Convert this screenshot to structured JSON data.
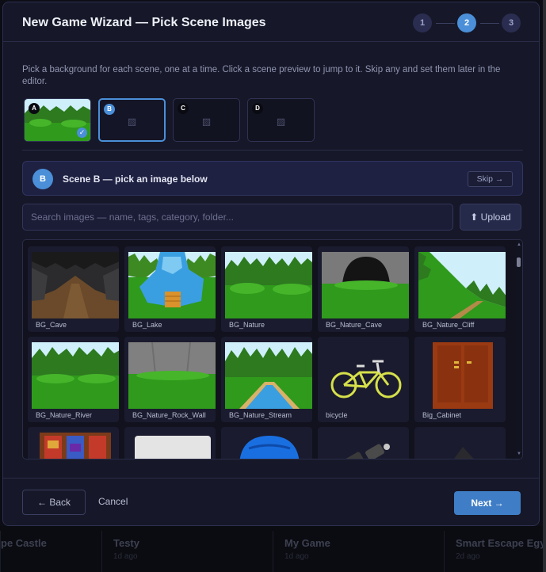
{
  "background": {
    "games": [
      {
        "title": "pe Castle",
        "sub": ""
      },
      {
        "title": "Testy",
        "sub": "1d ago"
      },
      {
        "title": "My Game",
        "sub": "1d ago"
      },
      {
        "title": "Smart Escape Egyp",
        "sub": "2d ago"
      }
    ]
  },
  "dialog": {
    "title": "New Game Wizard — Pick Scene Images",
    "steps": [
      "1",
      "2",
      "3"
    ],
    "active_step": 2,
    "intro": "Pick a background for each scene, one at a time. Click a scene preview to jump to it. Skip any and set them later in the editor.",
    "scenes": [
      {
        "letter": "A",
        "state": "done"
      },
      {
        "letter": "B",
        "state": "selected"
      },
      {
        "letter": "C",
        "state": "empty"
      },
      {
        "letter": "D",
        "state": "empty"
      }
    ],
    "current_scene": {
      "letter": "B",
      "label": "Scene B — pick an image below",
      "skip_label": "Skip →"
    },
    "search": {
      "placeholder": "Search images — name, tags, category, folder...",
      "value": ""
    },
    "upload_label": "⬆ Upload",
    "images": [
      {
        "name": "BG_Cave"
      },
      {
        "name": "BG_Lake"
      },
      {
        "name": "BG_Nature"
      },
      {
        "name": "BG_Nature_Cave"
      },
      {
        "name": "BG_Nature_Cliff"
      },
      {
        "name": "BG_Nature_River"
      },
      {
        "name": "BG_Nature_Rock_Wall"
      },
      {
        "name": "BG_Nature_Stream"
      },
      {
        "name": "bicycle"
      },
      {
        "name": "Big_Cabinet"
      },
      {
        "name": ""
      },
      {
        "name": ""
      },
      {
        "name": ""
      },
      {
        "name": ""
      },
      {
        "name": ""
      }
    ],
    "footer": {
      "back_label": "← Back",
      "cancel_label": "Cancel",
      "next_label": "Next →"
    },
    "colors": {
      "accent": "#4a8fd8",
      "modal_bg": "#161728",
      "grass": "#2f9a1c",
      "sky": "#cfeffb"
    }
  }
}
